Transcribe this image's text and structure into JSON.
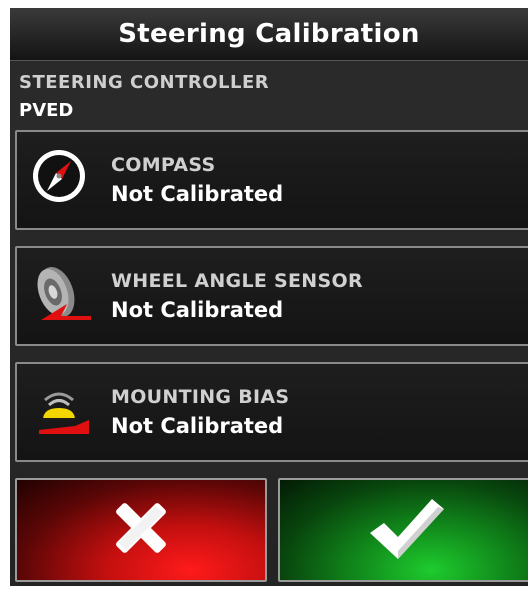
{
  "window": {
    "title": "Steering Calibration"
  },
  "controller": {
    "label": "STEERING CONTROLLER",
    "value": "PVED"
  },
  "items": [
    {
      "name": "COMPASS",
      "status": "Not Calibrated",
      "icon": "compass-icon"
    },
    {
      "name": "WHEEL ANGLE SENSOR",
      "status": "Not Calibrated",
      "icon": "wheel-angle-sensor-icon"
    },
    {
      "name": "MOUNTING BIAS",
      "status": "Not Calibrated",
      "icon": "mounting-bias-icon"
    }
  ],
  "buttons": {
    "cancel": {
      "icon": "close-icon",
      "color": "#e01010"
    },
    "confirm": {
      "icon": "check-icon",
      "color": "#18b324"
    }
  },
  "colors": {
    "accent_red": "#e01010",
    "accent_yellow": "#f2d600",
    "accent_green": "#18b324"
  }
}
